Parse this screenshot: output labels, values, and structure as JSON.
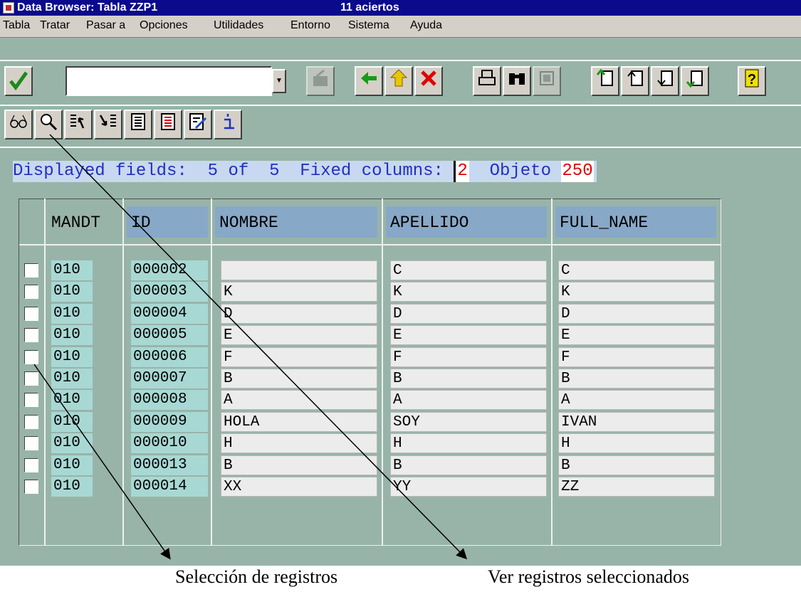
{
  "window": {
    "title": "Data Browser: Tabla ZZP1",
    "hits": "11 aciertos"
  },
  "menu": [
    "Tabla",
    "Tratar",
    "Pasar a",
    "Opciones",
    "Utilidades",
    "Entorno",
    "Sistema",
    "Ayuda"
  ],
  "toolbar": {
    "command_value": ""
  },
  "info": {
    "displayed_label": "Displayed fields:",
    "displayed_value": "5 of  5",
    "fixed_label": "Fixed columns:",
    "fixed_value": "2",
    "objeto_label": "Objeto",
    "objeto_value": "250"
  },
  "table": {
    "headers": [
      "MANDT",
      "ID",
      "NOMBRE",
      "APELLIDO",
      "FULL_NAME"
    ],
    "rows": [
      {
        "mandt": "010",
        "id": "000002",
        "nombre": "",
        "apellido": "C",
        "full_name": "C"
      },
      {
        "mandt": "010",
        "id": "000003",
        "nombre": "K",
        "apellido": "K",
        "full_name": "K"
      },
      {
        "mandt": "010",
        "id": "000004",
        "nombre": "D",
        "apellido": "D",
        "full_name": "D"
      },
      {
        "mandt": "010",
        "id": "000005",
        "nombre": "E",
        "apellido": "E",
        "full_name": "E"
      },
      {
        "mandt": "010",
        "id": "000006",
        "nombre": "F",
        "apellido": "F",
        "full_name": "F"
      },
      {
        "mandt": "010",
        "id": "000007",
        "nombre": "B",
        "apellido": "B",
        "full_name": "B"
      },
      {
        "mandt": "010",
        "id": "000008",
        "nombre": "A",
        "apellido": "A",
        "full_name": "A"
      },
      {
        "mandt": "010",
        "id": "000009",
        "nombre": "HOLA",
        "apellido": "SOY",
        "full_name": "IVAN"
      },
      {
        "mandt": "010",
        "id": "000010",
        "nombre": "H",
        "apellido": "H",
        "full_name": "H"
      },
      {
        "mandt": "010",
        "id": "000013",
        "nombre": "B",
        "apellido": "B",
        "full_name": "B"
      },
      {
        "mandt": "010",
        "id": "000014",
        "nombre": "XX",
        "apellido": "YY",
        "full_name": "ZZ"
      }
    ]
  },
  "annotations": {
    "select_records": "Selección de registros",
    "view_selected": "Ver registros seleccionados"
  },
  "colors": {
    "title_bar": "#0a0a8c",
    "workspace": "#98b4a8",
    "key_field": "#a8d8d4",
    "header_blue": "#88a8c8",
    "value_red": "#e00000",
    "info_blue": "#2030c0"
  }
}
